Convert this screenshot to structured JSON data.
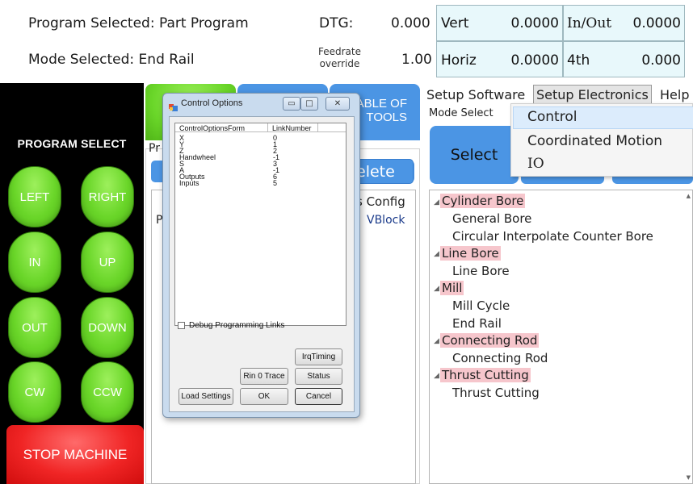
{
  "header": {
    "program_selected": "Program Selected: Part Program",
    "mode_selected": "Mode Selected: End Rail",
    "dtg_label": "DTG:",
    "dtg_value": "0.000",
    "feedrate_label_line1": "Feedrate",
    "feedrate_label_line2": "override",
    "feedrate_value": "1.00",
    "readouts": {
      "vert_label": "Vert",
      "vert_value": "0.0000",
      "inout_label": "In/Out",
      "inout_value": "0.0000",
      "horiz_label": "Horiz",
      "horiz_value": "0.0000",
      "fourth_label": "4th",
      "fourth_value": "0.000"
    }
  },
  "left_panel": {
    "title": "PROGRAM SELECT",
    "buttons": {
      "left": "LEFT",
      "right": "RIGHT",
      "in": "IN",
      "up": "UP",
      "out": "OUT",
      "down": "DOWN",
      "cw": "CW",
      "ccw": "CCW"
    },
    "stop": "STOP MACHINE"
  },
  "middle": {
    "tab3_line1": "ABLE OF",
    "tab3_line2": "TOOLS",
    "prog_label_partial": "Pr",
    "delete_partial": "elete",
    "config_partial": "s Config",
    "list_left_partial": "P",
    "vblock": "VBlock"
  },
  "menu": {
    "setup_software": "Setup Software",
    "setup_electronics": "Setup Electronics",
    "help": "Help",
    "mode_select": "Mode Select",
    "select_button": "Select",
    "dropdown": [
      "Control",
      "Coordinated Motion",
      "IO"
    ]
  },
  "tree": [
    {
      "label": "Cylinder Bore",
      "children": [
        "General Bore",
        "Circular Interpolate Counter Bore"
      ]
    },
    {
      "label": "Line Bore",
      "children": [
        "Line Bore"
      ]
    },
    {
      "label": "Mill",
      "children": [
        "Mill Cycle",
        "End Rail"
      ]
    },
    {
      "label": "Connecting Rod",
      "children": [
        "Connecting Rod"
      ]
    },
    {
      "label": "Thrust Cutting",
      "children": [
        "Thrust Cutting"
      ]
    }
  ],
  "dialog": {
    "title": "Control Options",
    "columns": [
      "ControlOptionsForm",
      "LinkNumber"
    ],
    "rows": [
      [
        "X",
        "0"
      ],
      [
        "Y",
        "1"
      ],
      [
        "Z",
        "2"
      ],
      [
        "Handwheel",
        "-1"
      ],
      [
        "S",
        "3"
      ],
      [
        "A",
        "-1"
      ],
      [
        "Outputs",
        "6"
      ],
      [
        "Inputs",
        "5"
      ]
    ],
    "debug_checkbox": "Debug Programming Links",
    "debug_checked": false,
    "buttons": {
      "irq_timing": "IrqTiming",
      "rin0_trace": "Rin 0 Trace",
      "status": "Status",
      "load_settings": "Load Settings",
      "ok": "OK",
      "cancel": "Cancel"
    }
  },
  "colors": {
    "green_button": "#6ad629",
    "stop_red": "#f02525",
    "readout_bg": "#e8f8fb",
    "tree_highlight": "#f6c6cc",
    "tab_blue": "#4b95e4",
    "dialog_frame": "#c9dbee"
  }
}
